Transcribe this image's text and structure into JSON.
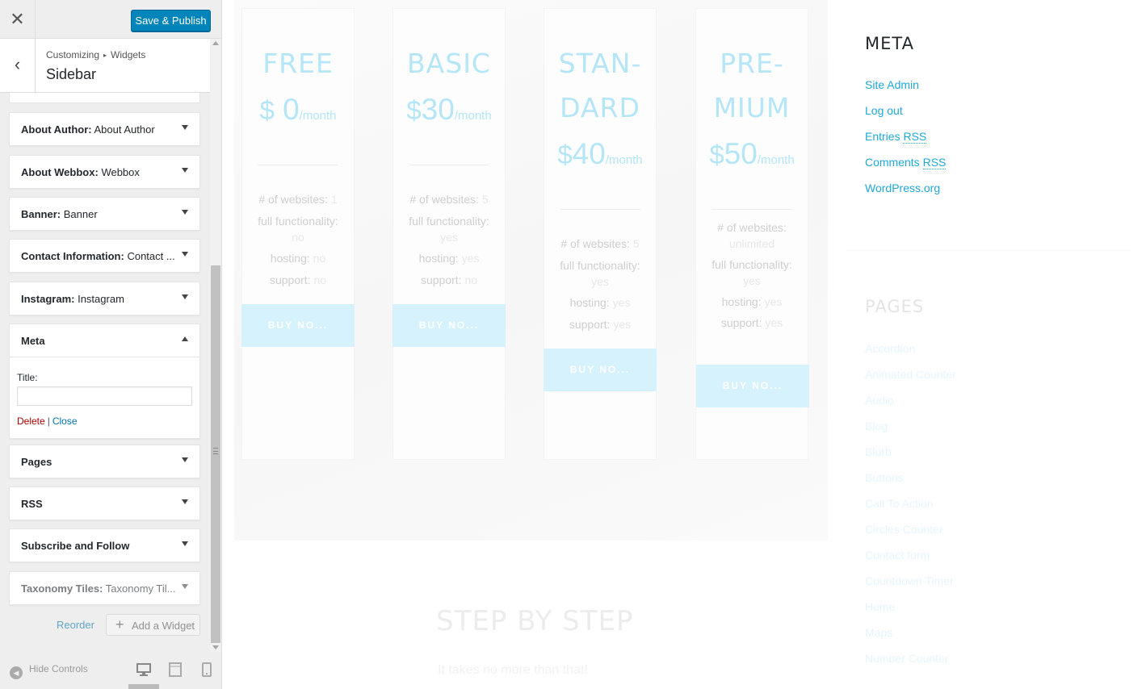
{
  "header": {
    "close_icon": "close-icon",
    "publish_label": "Save & Publish"
  },
  "section": {
    "back_icon": "back-arrow-icon",
    "crumb_parent": "Customizing",
    "crumb_child": "Widgets",
    "title": "Sidebar"
  },
  "widgets": [
    {
      "name": "About Author:",
      "title": "About Author"
    },
    {
      "name": "About Webbox:",
      "title": "Webbox"
    },
    {
      "name": "Banner:",
      "title": "Banner"
    },
    {
      "name": "Contact Information:",
      "title": "Contact ..."
    },
    {
      "name": "Instagram:",
      "title": "Instagram"
    },
    {
      "name": "Meta",
      "title": ""
    },
    {
      "name": "Pages",
      "title": ""
    },
    {
      "name": "RSS",
      "title": ""
    },
    {
      "name": "Subscribe and Follow",
      "title": ""
    },
    {
      "name": "Taxonomy Tiles:",
      "title": "Taxonomy Til..."
    }
  ],
  "meta_form": {
    "title_label": "Title:",
    "title_value": "",
    "delete_label": "Delete",
    "separator": "|",
    "close_label": "Close"
  },
  "footer": {
    "reorder_label": "Reorder",
    "add_widget_label": "Add a Widget",
    "hide_controls_label": "Hide Controls",
    "devices": [
      "desktop-icon",
      "tablet-icon",
      "mobile-icon"
    ]
  },
  "preview": {
    "plans": [
      {
        "name_lines": [
          "FREE"
        ],
        "currency": "$",
        "amount": " 0",
        "period": "/month",
        "features": [
          [
            "# of websites: ",
            "1"
          ],
          [
            "full functionality:",
            ""
          ],
          [
            "",
            "no"
          ],
          [
            "hosting: ",
            "no"
          ],
          [
            "support: ",
            "no"
          ]
        ],
        "button": "BUY NO..."
      },
      {
        "name_lines": [
          "BASIC"
        ],
        "currency": "$",
        "amount": "30",
        "period": "/month",
        "features": [
          [
            "# of websites: ",
            "5"
          ],
          [
            "full functionality:",
            ""
          ],
          [
            "",
            "yes"
          ],
          [
            "hosting: ",
            "yes"
          ],
          [
            "support: ",
            "no"
          ]
        ],
        "button": "BUY NO..."
      },
      {
        "name_lines": [
          "STAN-",
          "DARD"
        ],
        "currency": "$",
        "amount": "40",
        "period": "/month",
        "features": [
          [
            "# of websites: ",
            "5"
          ],
          [
            "full functionality:",
            ""
          ],
          [
            "",
            "yes"
          ],
          [
            "hosting: ",
            "yes"
          ],
          [
            "support: ",
            "yes"
          ]
        ],
        "button": "BUY NO..."
      },
      {
        "name_lines": [
          "PRE-",
          "MIUM"
        ],
        "currency": "$",
        "amount": "50",
        "period": "/month",
        "features": [
          [
            "# of websites:",
            ""
          ],
          [
            "",
            "unlimited"
          ],
          [
            "full functionality:",
            ""
          ],
          [
            "",
            "yes"
          ],
          [
            "hosting: ",
            "yes"
          ],
          [
            "support: ",
            "yes"
          ]
        ],
        "button": "BUY NO..."
      }
    ],
    "step_title": "STEP BY STEP",
    "step_subtitle": "It takes no more than that!",
    "meta": {
      "title": "META",
      "links": [
        "Site Admin",
        "Log out",
        "Entries",
        "Comments",
        "WordPress.org"
      ],
      "rss_abbr": "RSS"
    },
    "pages": {
      "title": "PAGES",
      "links": [
        "Accordion",
        "Animated Counter",
        "Audio",
        "Blog",
        "Blurb",
        "Buttons",
        "Call To Action",
        "Circles Counter",
        "Contact form",
        "Countdown Timer",
        "Home",
        "Maps",
        "Number Counter"
      ]
    }
  },
  "colors": {
    "accent": "#0085ba",
    "link": "#1fa8d8",
    "delete": "#aa0000"
  }
}
